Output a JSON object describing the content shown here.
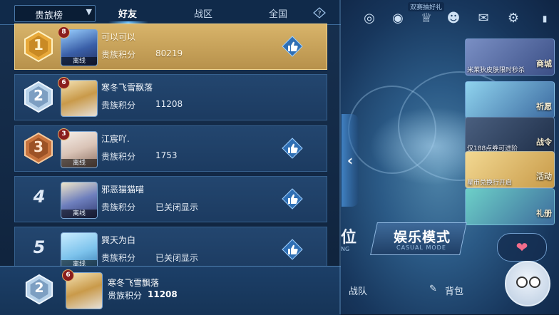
{
  "colors": {
    "accent": "#6ec3ff",
    "gold_row": "#d8b46a",
    "row_bg": "#1f3f66",
    "badge_gold": "#e8a93a",
    "badge_silver": "#b9d3ea",
    "badge_bronze": "#c8743e"
  },
  "header": {
    "dropdown_label": "贵族榜",
    "tabs": [
      {
        "label": "好友",
        "active": true
      },
      {
        "label": "战区",
        "active": false
      },
      {
        "label": "全国",
        "active": false
      }
    ],
    "help_icon": "question-icon"
  },
  "rows": [
    {
      "rank": "1",
      "level": "8",
      "name": "可以可以",
      "score_label": "贵族积分",
      "score": "80219",
      "offline": "离线"
    },
    {
      "rank": "2",
      "level": "6",
      "name": "寒冬飞雪飘落",
      "score_label": "贵族积分",
      "score": "11208",
      "offline": ""
    },
    {
      "rank": "3",
      "level": "3",
      "name": "江宸吖.",
      "score_label": "贵族积分",
      "score": "1753",
      "offline": "离线"
    },
    {
      "rank": "4",
      "level": "",
      "name": "邪恶猫猫喵",
      "score_label": "贵族积分",
      "score": "已关闭显示",
      "offline": "离线"
    },
    {
      "rank": "5",
      "level": "",
      "name": "巽天为白",
      "score_label": "贵族积分",
      "score": "已关闭显示",
      "offline": "离线"
    }
  ],
  "self": {
    "rank": "2",
    "level": "6",
    "name": "寒冬飞雪飘落",
    "score_label": "贵族积分",
    "score": "11208"
  },
  "right_side": {
    "ad_label": "双赛抽好礼",
    "cards": [
      {
        "caption": "米莱狄皮肤限时秒杀",
        "tag": "商城"
      },
      {
        "caption": "",
        "tag": "祈愿"
      },
      {
        "caption": "仅188点券可进阶",
        "tag": "战令"
      },
      {
        "caption": "星币兑换行开启",
        "tag": "活动"
      },
      {
        "caption": "",
        "tag": "礼册"
      }
    ],
    "mode_left": "位",
    "mode_left_sub": "NG",
    "mode_title": "娱乐模式",
    "mode_sub": "CASUAL MODE",
    "nav": {
      "team": "战队",
      "bag": "背包"
    },
    "collapse_arrow": "‹",
    "heart": "❤"
  }
}
